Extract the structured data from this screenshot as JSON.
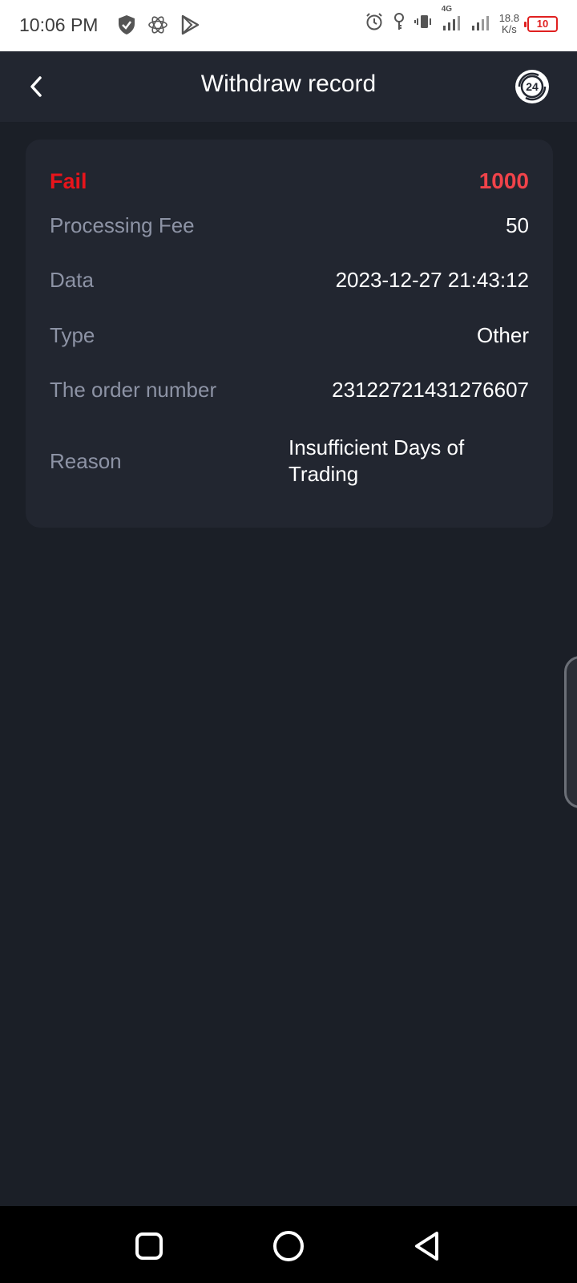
{
  "status_bar": {
    "time": "10:06 PM",
    "network_type": "4G",
    "net_speed_value": "18.8",
    "net_speed_unit": "K/s",
    "battery": "10"
  },
  "header": {
    "title": "Withdraw record"
  },
  "record": {
    "status": "Fail",
    "amount": "1000",
    "rows": [
      {
        "label": "Processing Fee",
        "value": "50"
      },
      {
        "label": "Data",
        "value": "2023-12-27 21:43:12"
      },
      {
        "label": "Type",
        "value": "Other"
      },
      {
        "label": "The order number",
        "value": "23122721431276607"
      },
      {
        "label": "Reason",
        "value": "Insufficient Days of Trading"
      }
    ]
  },
  "support_icon_text": "24",
  "colors": {
    "fail": "#e8141b",
    "amount": "#f0434a",
    "background": "#1b1f27",
    "card": "#222630"
  }
}
